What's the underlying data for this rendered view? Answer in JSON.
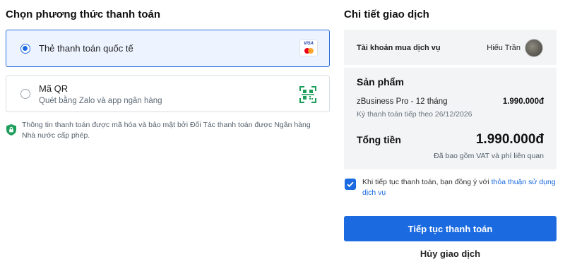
{
  "payment_methods": {
    "title": "Chọn phương thức thanh toán",
    "options": [
      {
        "label": "Thẻ thanh toán quốc tế",
        "selected": true,
        "icon": "credit-card-logos-icon",
        "card_brand_text": "VISA"
      },
      {
        "label": "Mã QR",
        "sublabel": "Quét bằng Zalo và app ngân hàng",
        "selected": false,
        "icon": "qr-code-icon"
      }
    ],
    "security_note": "Thông tin thanh toán được mã hóa và bảo mật bởi Đối Tác thanh toán được Ngân hàng Nhà nước cấp phép."
  },
  "transaction": {
    "title": "Chi tiết giao dịch",
    "account_label": "Tài khoản mua dịch vụ",
    "account_name": "Hiếu Trần",
    "product_heading": "Sản phẩm",
    "product_name": "zBusiness Pro - 12 tháng",
    "product_price": "1.990.000đ",
    "renewal_text": "Kỳ thanh toán tiếp theo 26/12/2026",
    "total_label": "Tổng tiền",
    "total_value": "1.990.000đ",
    "vat_note": "Đã bao gồm VAT và phí liên quan",
    "agree_prefix": "Khi tiếp tục thanh toán, bạn đồng ý với ",
    "agree_link": "thỏa thuận sử dụng dịch vụ",
    "agree_checked": true,
    "continue_label": "Tiếp tục thanh toán",
    "cancel_label": "Hủy giao dịch"
  },
  "colors": {
    "accent": "#1b6ae0",
    "selected_bg": "#eef4ff",
    "panel_bg": "#f2f4f6",
    "secure_green": "#1e9e5a"
  }
}
